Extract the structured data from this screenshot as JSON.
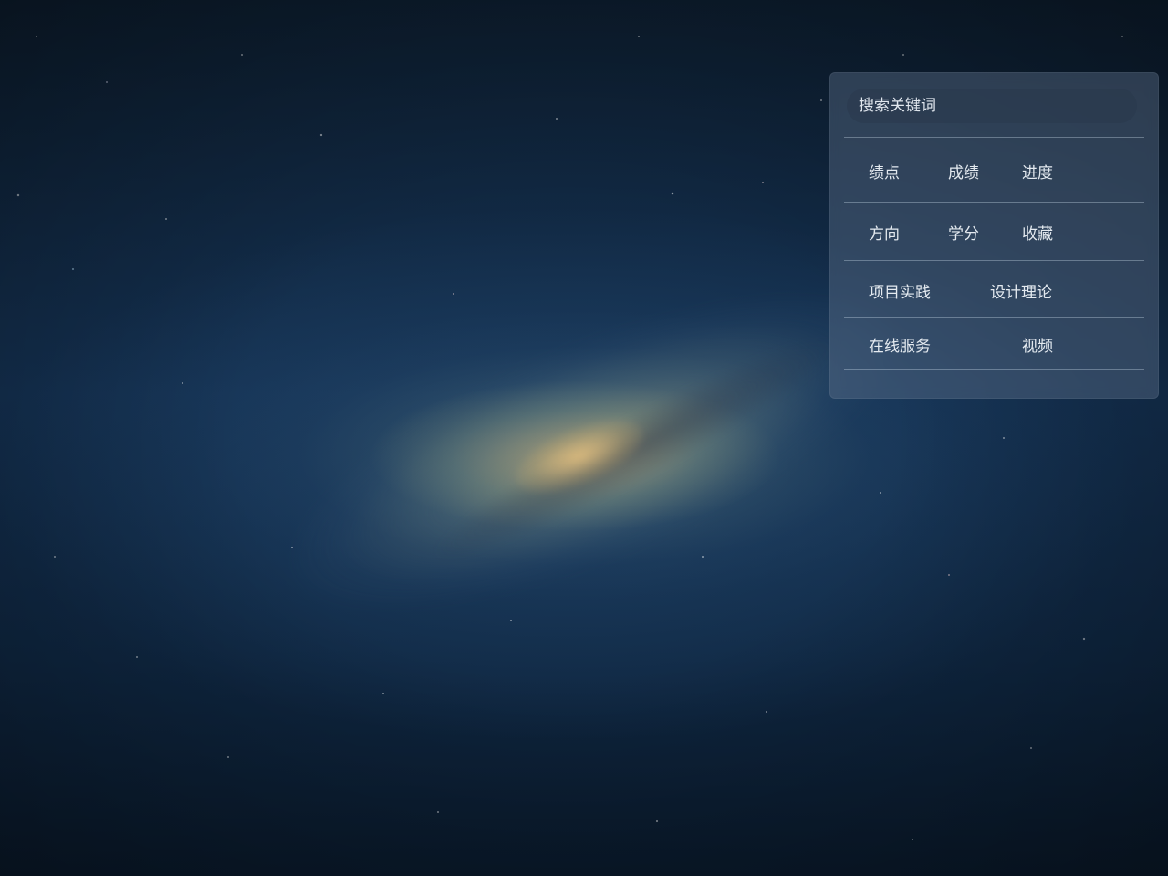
{
  "search": {
    "placeholder": "搜索关键词"
  },
  "menu": {
    "row1": [
      "绩点",
      "成绩",
      "进度"
    ],
    "row2": [
      "方向",
      "学分",
      "收藏"
    ],
    "row3": [
      "项目实践",
      "设计理论"
    ],
    "row4": [
      "在线服务",
      "视频"
    ]
  },
  "colors": {
    "panel_background": "#5f738c",
    "text": "#e4eaf0",
    "desktop_background": "#143152"
  }
}
